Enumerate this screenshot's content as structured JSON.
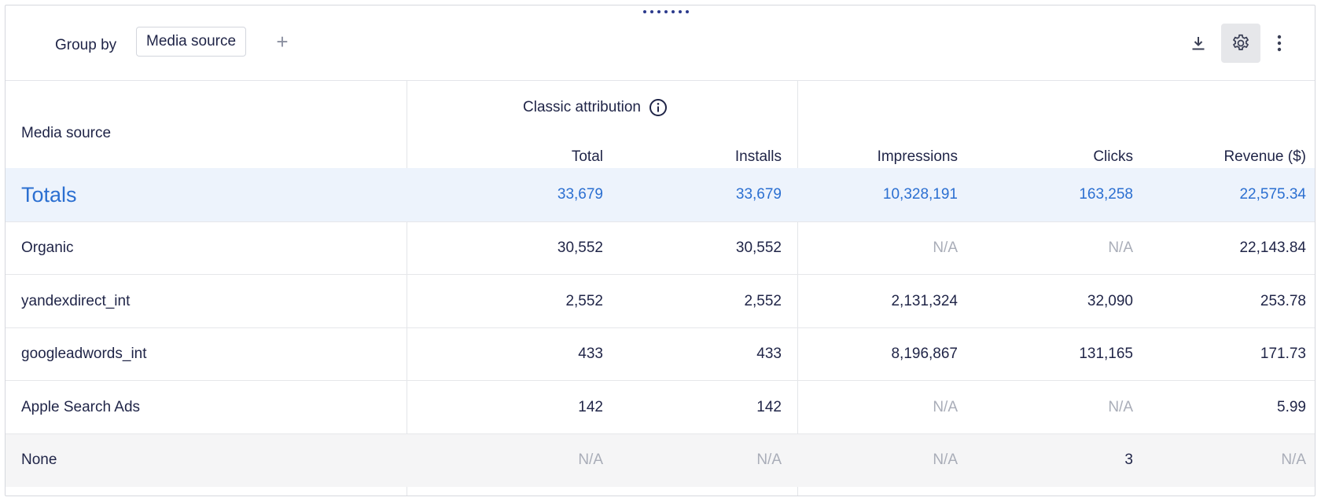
{
  "toolbar": {
    "group_by_label": "Group by",
    "group_chip": "Media source",
    "add_symbol": "+",
    "icons": {
      "download": "download-icon",
      "settings": "gear-icon",
      "more": "more-vertical-icon"
    }
  },
  "table": {
    "group_header": "Classic attribution",
    "columns": {
      "media_source": "Media source",
      "total": "Total",
      "installs": "Installs",
      "impressions": "Impressions",
      "clicks": "Clicks",
      "revenue": "Revenue ($)"
    },
    "totals": {
      "name": "Totals",
      "total": "33,679",
      "installs": "33,679",
      "impressions": "10,328,191",
      "clicks": "163,258",
      "revenue": "22,575.34"
    },
    "rows": [
      {
        "name": "Organic",
        "total": "30,552",
        "installs": "30,552",
        "impressions": "N/A",
        "clicks": "N/A",
        "revenue": "22,143.84"
      },
      {
        "name": "yandexdirect_int",
        "total": "2,552",
        "installs": "2,552",
        "impressions": "2,131,324",
        "clicks": "32,090",
        "revenue": "253.78"
      },
      {
        "name": "googleadwords_int",
        "total": "433",
        "installs": "433",
        "impressions": "8,196,867",
        "clicks": "131,165",
        "revenue": "171.73"
      },
      {
        "name": "Apple Search Ads",
        "total": "142",
        "installs": "142",
        "impressions": "N/A",
        "clicks": "N/A",
        "revenue": "5.99"
      },
      {
        "name": "None",
        "total": "N/A",
        "installs": "N/A",
        "impressions": "N/A",
        "clicks": "3",
        "revenue": "N/A"
      }
    ]
  },
  "colors": {
    "accent": "#2b6fd1",
    "totals_bg": "#edf3fc",
    "text": "#1f2447",
    "na": "#a9adb8"
  }
}
